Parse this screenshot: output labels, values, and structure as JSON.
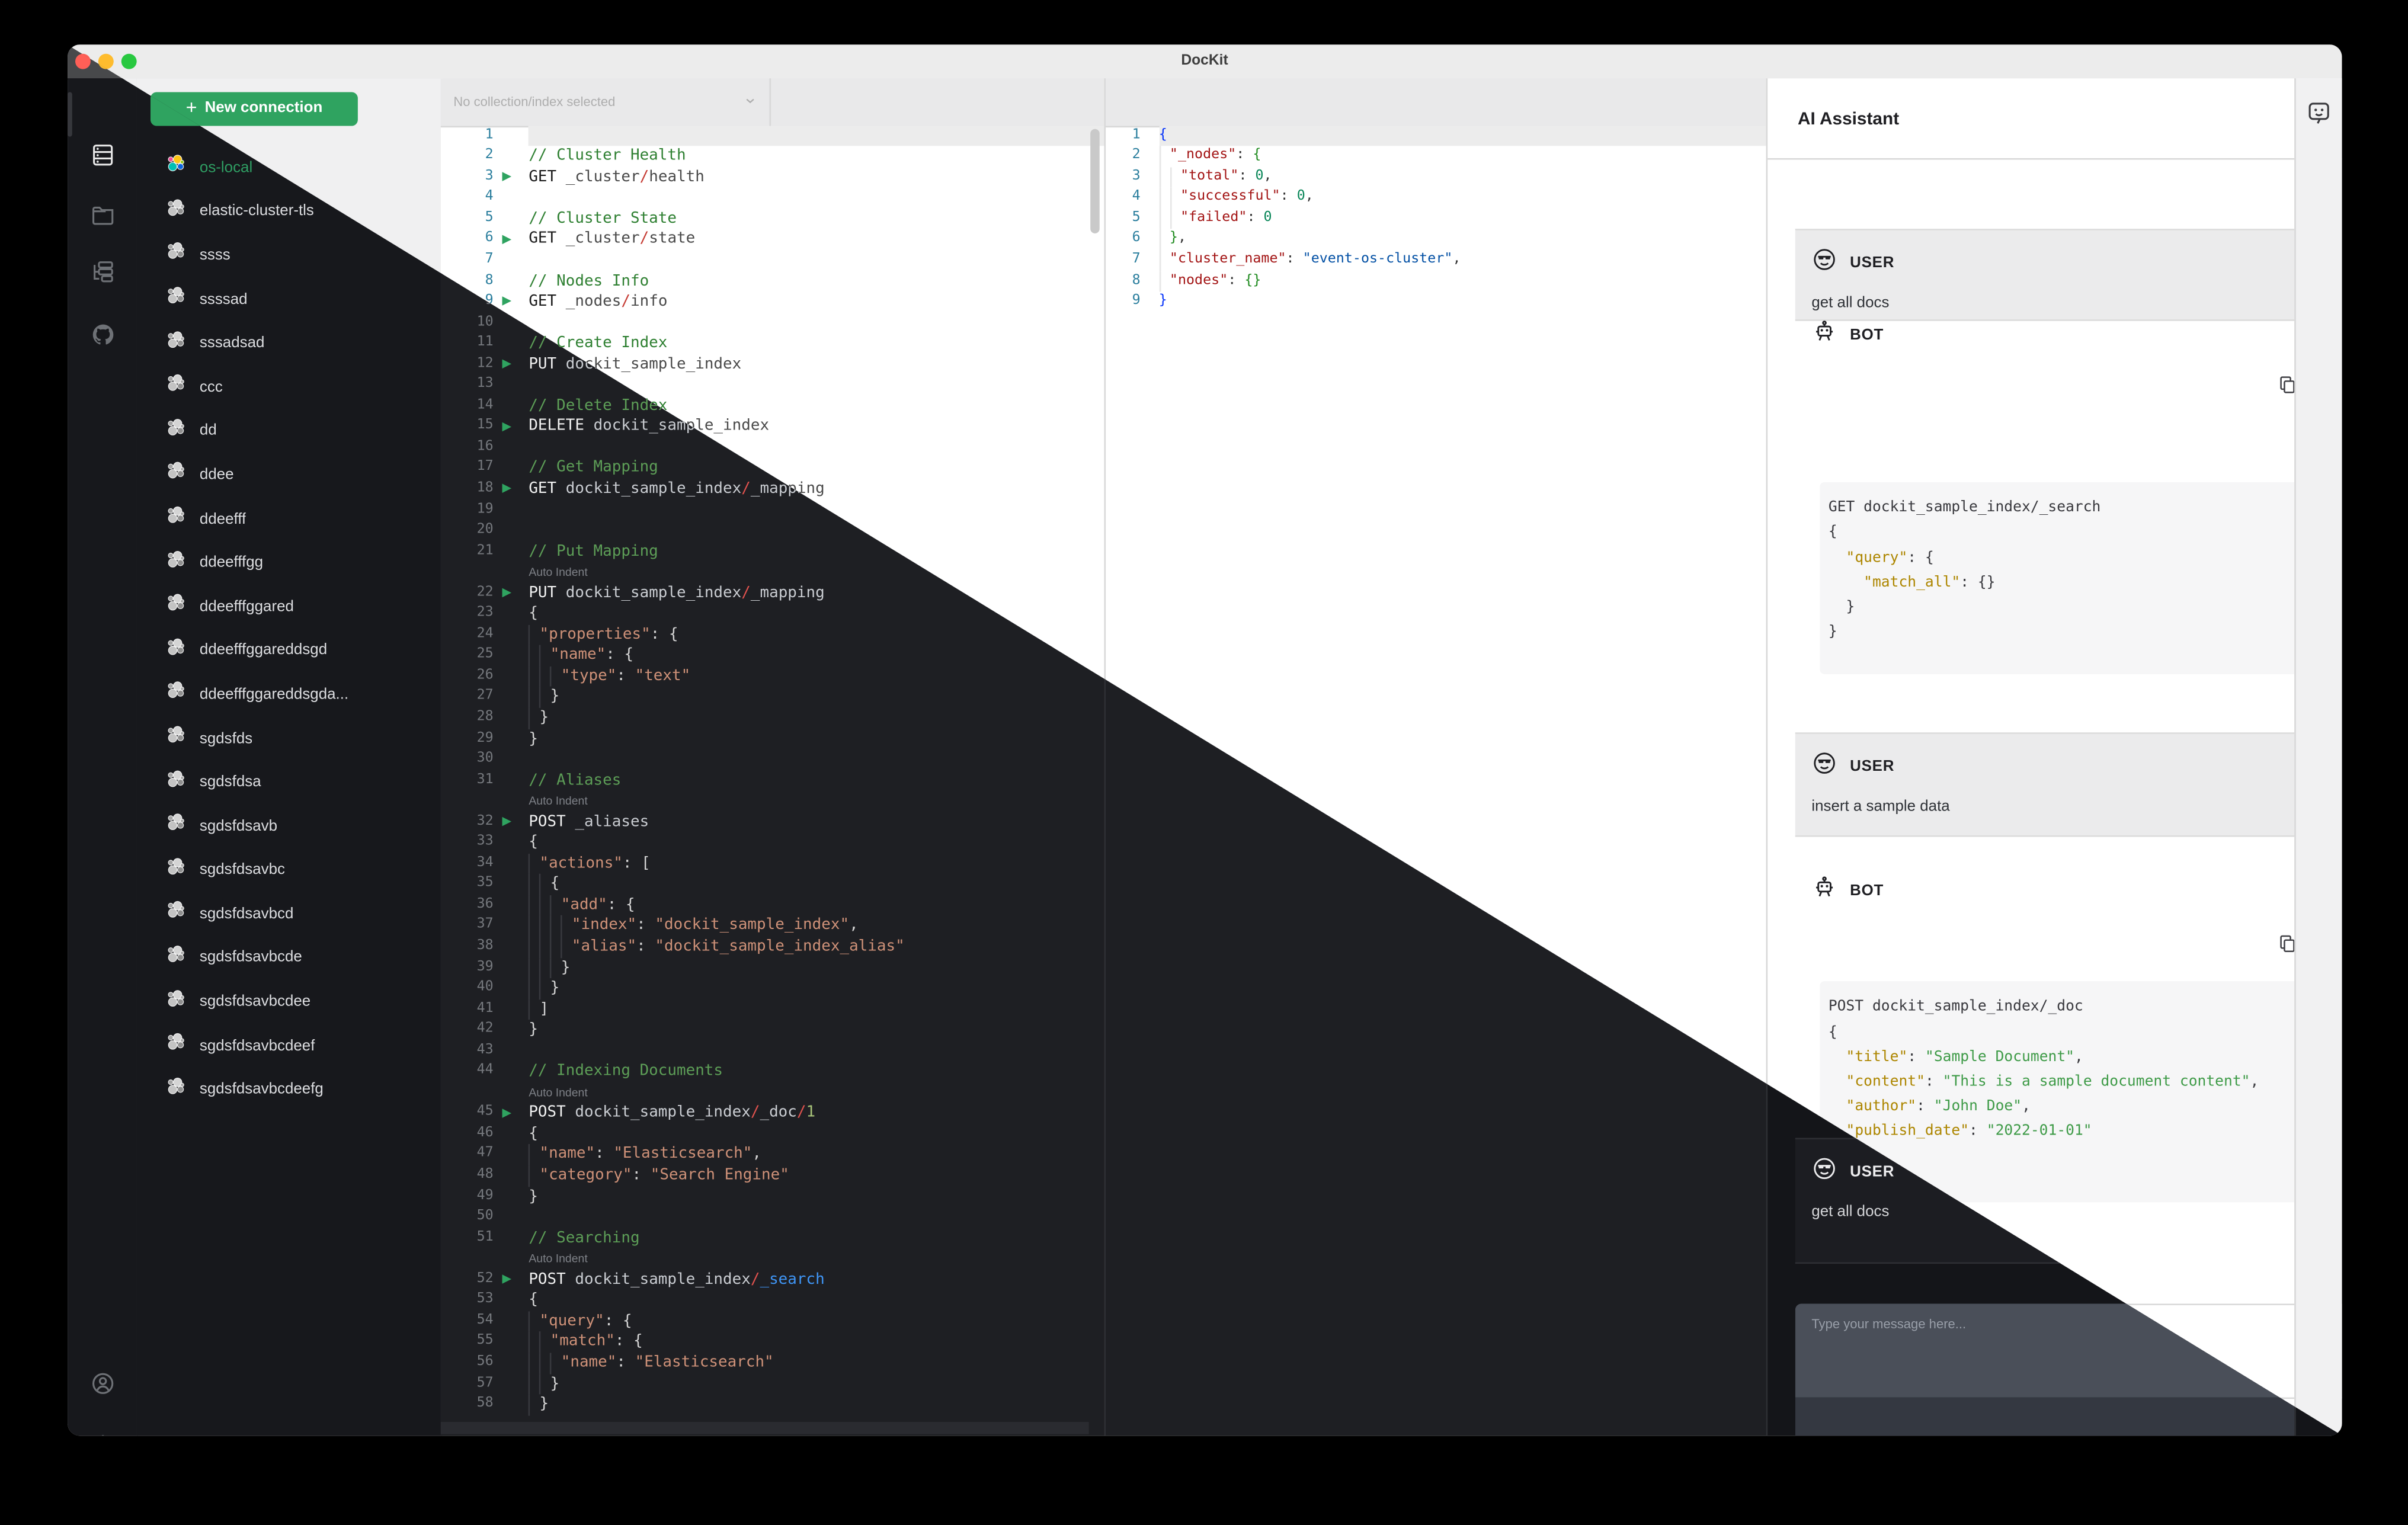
{
  "window": {
    "title": "DocKit"
  },
  "colors": {
    "accent_green": "#2fa360",
    "traffic_red": "#ff5f57",
    "traffic_yellow": "#febc2e",
    "traffic_green": "#28c840",
    "active_connection_green": "#2f9e63",
    "dark_bg": "#17181c",
    "light_toolbar": "#e9e9ea",
    "code_key_gold": "#ad8600",
    "code_string_green": "#3f9b48",
    "editor_string_salmon": "#ce9178",
    "slash_red": "#e0524e",
    "search_blue": "#3f95f5"
  },
  "activity_bar": {
    "top_items": [
      {
        "icon": "servers-icon",
        "active": true
      },
      {
        "icon": "folder-icon",
        "active": false
      },
      {
        "icon": "collections-icon",
        "active": false
      },
      {
        "icon": "github-icon",
        "active": false
      }
    ],
    "bottom_items": [
      {
        "icon": "user-icon",
        "active": false
      },
      {
        "icon": "gear-icon",
        "active": false
      }
    ]
  },
  "connections": {
    "new_button_label": "New connection",
    "plus": "+",
    "items": [
      {
        "name": "os-local",
        "active": true
      },
      {
        "name": "elastic-cluster-tls",
        "active": false
      },
      {
        "name": "ssss",
        "active": false
      },
      {
        "name": "ssssad",
        "active": false
      },
      {
        "name": "sssadsad",
        "active": false
      },
      {
        "name": "ccc",
        "active": false
      },
      {
        "name": "dd",
        "active": false
      },
      {
        "name": "ddee",
        "active": false
      },
      {
        "name": "ddeefff",
        "active": false
      },
      {
        "name": "ddeefffgg",
        "active": false
      },
      {
        "name": "ddeefffggared",
        "active": false
      },
      {
        "name": "ddeefffggareddsgd",
        "active": false
      },
      {
        "name": "ddeefffggareddsgda...",
        "active": false
      },
      {
        "name": "sgdsfds",
        "active": false
      },
      {
        "name": "sgdsfdsa",
        "active": false
      },
      {
        "name": "sgdsfdsavb",
        "active": false
      },
      {
        "name": "sgdsfdsavbc",
        "active": false
      },
      {
        "name": "sgdsfdsavbcd",
        "active": false
      },
      {
        "name": "sgdsfdsavbcde",
        "active": false
      },
      {
        "name": "sgdsfdsavbcdee",
        "active": false
      },
      {
        "name": "sgdsfdsavbcdeef",
        "active": false
      },
      {
        "name": "sgdsfdsavbcdeefg",
        "active": false
      }
    ]
  },
  "toolbar": {
    "collection_placeholder": "No collection/index selected"
  },
  "editor": {
    "auto_indent_label": "Auto Indent",
    "lines": [
      {
        "n": 1,
        "cur": 1,
        "s": []
      },
      {
        "n": 2,
        "s": [
          [
            "// Cluster Health",
            "cm"
          ]
        ]
      },
      {
        "n": 3,
        "p": 1,
        "s": [
          [
            "GET ",
            "kw"
          ],
          [
            "_cluster",
            "pa"
          ],
          [
            "/",
            "sl"
          ],
          [
            "health",
            "pa"
          ]
        ]
      },
      {
        "n": 4,
        "s": []
      },
      {
        "n": 5,
        "s": [
          [
            "// Cluster State",
            "cm"
          ]
        ]
      },
      {
        "n": 6,
        "p": 1,
        "s": [
          [
            "GET ",
            "kw"
          ],
          [
            "_cluster",
            "pa"
          ],
          [
            "/",
            "sl"
          ],
          [
            "state",
            "pa"
          ]
        ]
      },
      {
        "n": 7,
        "s": []
      },
      {
        "n": 8,
        "s": [
          [
            "// Nodes Info",
            "cm"
          ]
        ]
      },
      {
        "n": 9,
        "p": 1,
        "s": [
          [
            "GET ",
            "kw"
          ],
          [
            "_nodes",
            "pa"
          ],
          [
            "/",
            "sl"
          ],
          [
            "info",
            "pa"
          ]
        ]
      },
      {
        "n": 10,
        "s": []
      },
      {
        "n": 11,
        "s": [
          [
            "// Create Index",
            "cm"
          ]
        ]
      },
      {
        "n": 12,
        "p": 1,
        "s": [
          [
            "PUT ",
            "kw"
          ],
          [
            "dockit_sample_index",
            "pa"
          ]
        ]
      },
      {
        "n": 13,
        "s": []
      },
      {
        "n": 14,
        "s": [
          [
            "// Delete Index",
            "cm"
          ]
        ]
      },
      {
        "n": 15,
        "p": 1,
        "s": [
          [
            "DELETE ",
            "kw"
          ],
          [
            "dockit_sample_index",
            "pa"
          ]
        ]
      },
      {
        "n": 16,
        "s": []
      },
      {
        "n": 17,
        "s": [
          [
            "// Get Mapping",
            "cm"
          ]
        ]
      },
      {
        "n": 18,
        "p": 1,
        "s": [
          [
            "GET ",
            "kw"
          ],
          [
            "dockit_sample_index",
            "pa"
          ],
          [
            "/",
            "sl"
          ],
          [
            "_mapping",
            "pa"
          ]
        ]
      },
      {
        "n": 19,
        "s": []
      },
      {
        "n": 20,
        "s": []
      },
      {
        "n": 21,
        "s": [
          [
            "// Put Mapping",
            "cm"
          ]
        ]
      },
      {
        "n": 22,
        "p": 1,
        "w": 1,
        "s": [
          [
            "PUT ",
            "kw"
          ],
          [
            "dockit_sample_index",
            "pa"
          ],
          [
            "/",
            "sl"
          ],
          [
            "_mapping",
            "pa"
          ]
        ]
      },
      {
        "n": 23,
        "s": [
          [
            "{",
            "br"
          ]
        ]
      },
      {
        "n": 24,
        "d": 1,
        "s": [
          [
            "\"properties\"",
            "key"
          ],
          [
            ": ",
            "pun"
          ],
          [
            "{",
            "br"
          ]
        ]
      },
      {
        "n": 25,
        "d": 2,
        "s": [
          [
            "\"name\"",
            "key"
          ],
          [
            ": ",
            "pun"
          ],
          [
            "{",
            "br"
          ]
        ]
      },
      {
        "n": 26,
        "d": 3,
        "s": [
          [
            "\"type\"",
            "key"
          ],
          [
            ": ",
            "pun"
          ],
          [
            "\"text\"",
            "str"
          ]
        ]
      },
      {
        "n": 27,
        "d": 2,
        "s": [
          [
            "}",
            "br"
          ]
        ]
      },
      {
        "n": 28,
        "d": 1,
        "s": [
          [
            "}",
            "br"
          ]
        ]
      },
      {
        "n": 29,
        "s": [
          [
            "}",
            "br"
          ]
        ]
      },
      {
        "n": 30,
        "s": []
      },
      {
        "n": 31,
        "s": [
          [
            "// Aliases",
            "cm"
          ]
        ]
      },
      {
        "n": 32,
        "p": 1,
        "w": 1,
        "s": [
          [
            "POST ",
            "kw"
          ],
          [
            "_aliases",
            "pa"
          ]
        ]
      },
      {
        "n": 33,
        "s": [
          [
            "{",
            "br"
          ]
        ]
      },
      {
        "n": 34,
        "d": 1,
        "s": [
          [
            "\"actions\"",
            "key"
          ],
          [
            ": ",
            "pun"
          ],
          [
            "[",
            "br"
          ]
        ]
      },
      {
        "n": 35,
        "d": 2,
        "s": [
          [
            "{",
            "br"
          ]
        ]
      },
      {
        "n": 36,
        "d": 3,
        "s": [
          [
            "\"add\"",
            "key"
          ],
          [
            ": ",
            "pun"
          ],
          [
            "{",
            "br"
          ]
        ]
      },
      {
        "n": 37,
        "d": 4,
        "s": [
          [
            "\"index\"",
            "key"
          ],
          [
            ": ",
            "pun"
          ],
          [
            "\"dockit_sample_index\"",
            "str"
          ],
          [
            ",",
            "pun"
          ]
        ]
      },
      {
        "n": 38,
        "d": 4,
        "s": [
          [
            "\"alias\"",
            "key"
          ],
          [
            ": ",
            "pun"
          ],
          [
            "\"dockit_sample_index_alias\"",
            "str"
          ]
        ]
      },
      {
        "n": 39,
        "d": 3,
        "s": [
          [
            "}",
            "br"
          ]
        ]
      },
      {
        "n": 40,
        "d": 2,
        "s": [
          [
            "}",
            "br"
          ]
        ]
      },
      {
        "n": 41,
        "d": 1,
        "s": [
          [
            "]",
            "br"
          ]
        ]
      },
      {
        "n": 42,
        "s": [
          [
            "}",
            "br"
          ]
        ]
      },
      {
        "n": 43,
        "s": []
      },
      {
        "n": 44,
        "s": [
          [
            "// Indexing Documents",
            "cm"
          ]
        ]
      },
      {
        "n": 45,
        "p": 1,
        "w": 1,
        "s": [
          [
            "POST ",
            "kw"
          ],
          [
            "dockit_sample_index",
            "pa"
          ],
          [
            "/",
            "sl"
          ],
          [
            "_doc",
            "pa"
          ],
          [
            "/",
            "sl"
          ],
          [
            "1",
            "num"
          ]
        ]
      },
      {
        "n": 46,
        "s": [
          [
            "{",
            "br"
          ]
        ]
      },
      {
        "n": 47,
        "d": 1,
        "s": [
          [
            "\"name\"",
            "key"
          ],
          [
            ": ",
            "pun"
          ],
          [
            "\"Elasticsearch\"",
            "str"
          ],
          [
            ",",
            "pun"
          ]
        ]
      },
      {
        "n": 48,
        "d": 1,
        "s": [
          [
            "\"category\"",
            "key"
          ],
          [
            ": ",
            "pun"
          ],
          [
            "\"Search Engine\"",
            "str"
          ]
        ]
      },
      {
        "n": 49,
        "s": [
          [
            "}",
            "br"
          ]
        ]
      },
      {
        "n": 50,
        "s": []
      },
      {
        "n": 51,
        "s": [
          [
            "// Searching",
            "cm"
          ]
        ]
      },
      {
        "n": 52,
        "p": 1,
        "w": 1,
        "s": [
          [
            "POST ",
            "kw"
          ],
          [
            "dockit_sample_index",
            "pa"
          ],
          [
            "/",
            "sl"
          ],
          [
            "_search",
            "bl"
          ]
        ]
      },
      {
        "n": 53,
        "s": [
          [
            "{",
            "br"
          ]
        ]
      },
      {
        "n": 54,
        "d": 1,
        "s": [
          [
            "\"query\"",
            "key"
          ],
          [
            ": ",
            "pun"
          ],
          [
            "{",
            "br"
          ]
        ]
      },
      {
        "n": 55,
        "d": 2,
        "s": [
          [
            "\"match\"",
            "key"
          ],
          [
            ": ",
            "pun"
          ],
          [
            "{",
            "br"
          ]
        ]
      },
      {
        "n": 56,
        "d": 3,
        "s": [
          [
            "\"name\"",
            "key"
          ],
          [
            ": ",
            "pun"
          ],
          [
            "\"Elasticsearch\"",
            "str"
          ]
        ]
      },
      {
        "n": 57,
        "d": 2,
        "s": [
          [
            "}",
            "br"
          ]
        ]
      },
      {
        "n": 58,
        "d": 1,
        "s": [
          [
            "}",
            "br"
          ]
        ]
      }
    ]
  },
  "response": {
    "lines": [
      {
        "n": 1,
        "cur": 1,
        "s": [
          [
            "{",
            "b0"
          ]
        ]
      },
      {
        "n": 2,
        "d": 1,
        "s": [
          [
            "\"_nodes\"",
            "rk"
          ],
          [
            ": ",
            "rpun"
          ],
          [
            "{",
            "b1"
          ]
        ]
      },
      {
        "n": 3,
        "d": 2,
        "s": [
          [
            "\"total\"",
            "rk"
          ],
          [
            ": ",
            "rpun"
          ],
          [
            "0",
            "rn"
          ],
          [
            ",",
            "rpun"
          ]
        ]
      },
      {
        "n": 4,
        "d": 2,
        "s": [
          [
            "\"successful\"",
            "rk"
          ],
          [
            ": ",
            "rpun"
          ],
          [
            "0",
            "rn"
          ],
          [
            ",",
            "rpun"
          ]
        ]
      },
      {
        "n": 5,
        "d": 2,
        "s": [
          [
            "\"failed\"",
            "rk"
          ],
          [
            ": ",
            "rpun"
          ],
          [
            "0",
            "rn"
          ]
        ]
      },
      {
        "n": 6,
        "d": 1,
        "s": [
          [
            "}",
            "b1"
          ],
          [
            ",",
            "rpun"
          ]
        ]
      },
      {
        "n": 7,
        "d": 1,
        "s": [
          [
            "\"cluster_name\"",
            "rk"
          ],
          [
            ": ",
            "rpun"
          ],
          [
            "\"event-os-cluster\"",
            "rs"
          ],
          [
            ",",
            "rpun"
          ]
        ]
      },
      {
        "n": 8,
        "d": 1,
        "s": [
          [
            "\"nodes\"",
            "rk"
          ],
          [
            ": ",
            "rpun"
          ],
          [
            "{}",
            "b1"
          ]
        ]
      },
      {
        "n": 9,
        "s": [
          [
            "}",
            "b0"
          ]
        ]
      }
    ]
  },
  "ai": {
    "title": "AI Assistant",
    "user_label": "USER",
    "bot_label": "BOT",
    "input_placeholder": "Type your message here...",
    "light_messages": [
      {
        "role": "user",
        "text": "get all docs"
      },
      {
        "role": "bot",
        "code": [
          [
            [
              "GET dockit_sample_index/_search",
              "cp"
            ]
          ],
          [
            [
              "{",
              "cp"
            ]
          ],
          [
            [
              "  ",
              "cp"
            ],
            [
              "\"query\"",
              "ck"
            ],
            [
              ": {",
              "cp"
            ]
          ],
          [
            [
              "    ",
              "cp"
            ],
            [
              "\"match_all\"",
              "ck"
            ],
            [
              ": {}",
              "cp"
            ]
          ],
          [
            [
              "  }",
              "cp"
            ]
          ],
          [
            [
              "}",
              "cp"
            ]
          ]
        ]
      },
      {
        "role": "user",
        "text": "insert a sample data"
      },
      {
        "role": "bot",
        "code": [
          [
            [
              "POST dockit_sample_index/_doc",
              "cp"
            ]
          ],
          [
            [
              "{",
              "cp"
            ]
          ],
          [
            [
              "  ",
              "cp"
            ],
            [
              "\"title\"",
              "ck"
            ],
            [
              ": ",
              "cp"
            ],
            [
              "\"Sample Document\"",
              "cs"
            ],
            [
              ",",
              "cp"
            ]
          ],
          [
            [
              "  ",
              "cp"
            ],
            [
              "\"content\"",
              "ck"
            ],
            [
              ": ",
              "cp"
            ],
            [
              "\"This is a sample document content\"",
              "cs"
            ],
            [
              ",",
              "cp"
            ]
          ],
          [
            [
              "  ",
              "cp"
            ],
            [
              "\"author\"",
              "ck"
            ],
            [
              ": ",
              "cp"
            ],
            [
              "\"John Doe\"",
              "cs"
            ],
            [
              ",",
              "cp"
            ]
          ],
          [
            [
              "  ",
              "cp"
            ],
            [
              "\"publish_date\"",
              "ck"
            ],
            [
              ": ",
              "cp"
            ],
            [
              "\"2022-01-01\"",
              "cs"
            ]
          ],
          [
            [
              "}",
              "cp"
            ]
          ]
        ]
      }
    ],
    "dark_messages": [
      {
        "role": "user",
        "text": "get all docs"
      }
    ]
  }
}
